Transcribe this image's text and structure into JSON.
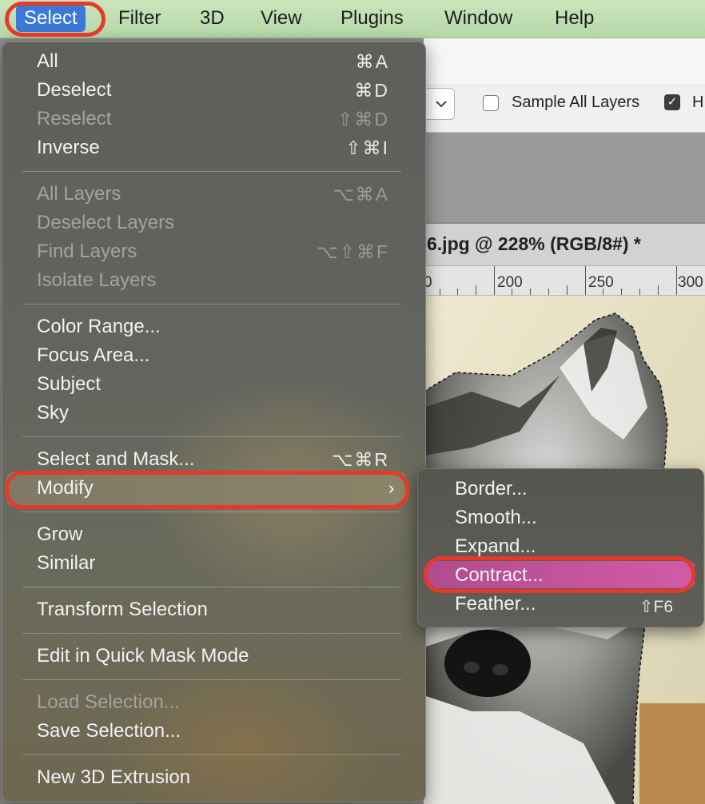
{
  "menubar": {
    "items": [
      "Select",
      "Filter",
      "3D",
      "View",
      "Plugins",
      "Window",
      "Help"
    ]
  },
  "toolbar": {
    "sample_all_layers_label": "Sample All Layers",
    "partial_label": "H"
  },
  "document": {
    "tab_title": "6.jpg @ 228% (RGB/8#) *",
    "ruler_labels": [
      "0",
      "200",
      "250",
      "300"
    ]
  },
  "select_menu": {
    "groups": [
      [
        {
          "label": "All",
          "shortcut": "⌘A",
          "enabled": true
        },
        {
          "label": "Deselect",
          "shortcut": "⌘D",
          "enabled": true
        },
        {
          "label": "Reselect",
          "shortcut": "⇧⌘D",
          "enabled": false
        },
        {
          "label": "Inverse",
          "shortcut": "⇧⌘I",
          "enabled": true
        }
      ],
      [
        {
          "label": "All Layers",
          "shortcut": "⌥⌘A",
          "enabled": false
        },
        {
          "label": "Deselect Layers",
          "shortcut": "",
          "enabled": false
        },
        {
          "label": "Find Layers",
          "shortcut": "⌥⇧⌘F",
          "enabled": false
        },
        {
          "label": "Isolate Layers",
          "shortcut": "",
          "enabled": false
        }
      ],
      [
        {
          "label": "Color Range...",
          "shortcut": "",
          "enabled": true
        },
        {
          "label": "Focus Area...",
          "shortcut": "",
          "enabled": true
        },
        {
          "label": "Subject",
          "shortcut": "",
          "enabled": true
        },
        {
          "label": "Sky",
          "shortcut": "",
          "enabled": true
        }
      ],
      [
        {
          "label": "Select and Mask...",
          "shortcut": "⌥⌘R",
          "enabled": true
        },
        {
          "label": "Modify",
          "shortcut": "",
          "enabled": true
        }
      ],
      [
        {
          "label": "Grow",
          "shortcut": "",
          "enabled": true
        },
        {
          "label": "Similar",
          "shortcut": "",
          "enabled": true
        }
      ],
      [
        {
          "label": "Transform Selection",
          "shortcut": "",
          "enabled": true
        }
      ],
      [
        {
          "label": "Edit in Quick Mask Mode",
          "shortcut": "",
          "enabled": true
        }
      ],
      [
        {
          "label": "Load Selection...",
          "shortcut": "",
          "enabled": false
        },
        {
          "label": "Save Selection...",
          "shortcut": "",
          "enabled": true
        }
      ],
      [
        {
          "label": "New 3D Extrusion",
          "shortcut": "",
          "enabled": true
        }
      ]
    ],
    "submenu_arrow": "›"
  },
  "modify_submenu": {
    "items": [
      {
        "label": "Border...",
        "shortcut": ""
      },
      {
        "label": "Smooth...",
        "shortcut": ""
      },
      {
        "label": "Expand...",
        "shortcut": ""
      },
      {
        "label": "Contract...",
        "shortcut": ""
      },
      {
        "label": "Feather...",
        "shortcut": "⇧F6"
      }
    ]
  },
  "colors": {
    "menubar_bg": "#c2e0b4",
    "active_menu": "#3a79d8",
    "submenu_highlight": "#c4539e",
    "annotation_ring": "#e53a2a"
  }
}
